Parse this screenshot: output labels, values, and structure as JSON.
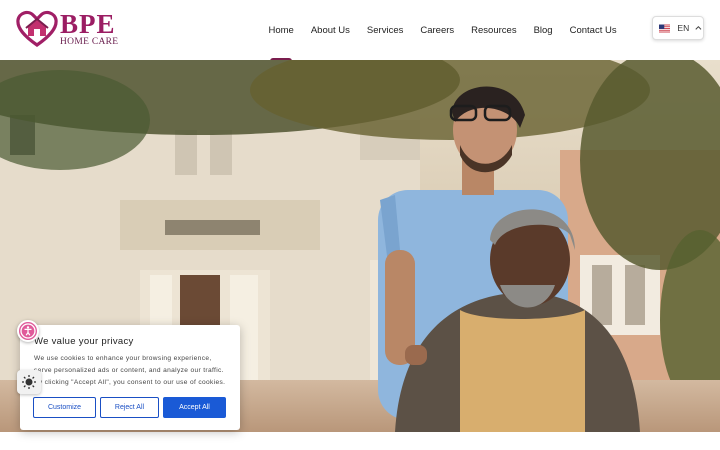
{
  "brand": {
    "name": "BPE",
    "subtitle": "HOME CARE",
    "color": "#9b1d63"
  },
  "nav": {
    "items": [
      {
        "label": "Home",
        "active": true
      },
      {
        "label": "About Us"
      },
      {
        "label": "Services"
      },
      {
        "label": "Careers"
      },
      {
        "label": "Resources"
      },
      {
        "label": "Blog"
      },
      {
        "label": "Contact Us"
      }
    ],
    "active_color": "#7a1d4e"
  },
  "language": {
    "code": "EN",
    "flag_icon": "us-flag-icon",
    "toggle_icon": "chevron-up-icon"
  },
  "cookie_banner": {
    "title": "We value your privacy",
    "lines": [
      "We use cookies to enhance your browsing experience,",
      "serve personalized ads or content, and analyze our traffic.",
      "By clicking \"Accept All\", you consent to our use of cookies."
    ],
    "buttons": {
      "customize": "Customize",
      "reject": "Reject All",
      "accept": "Accept All"
    },
    "accent": "#1a5ad6"
  },
  "widgets": {
    "accessibility_icon": "accessibility-icon",
    "brightness_icon": "brightness-icon",
    "accessibility_color": "#e05a9a"
  }
}
